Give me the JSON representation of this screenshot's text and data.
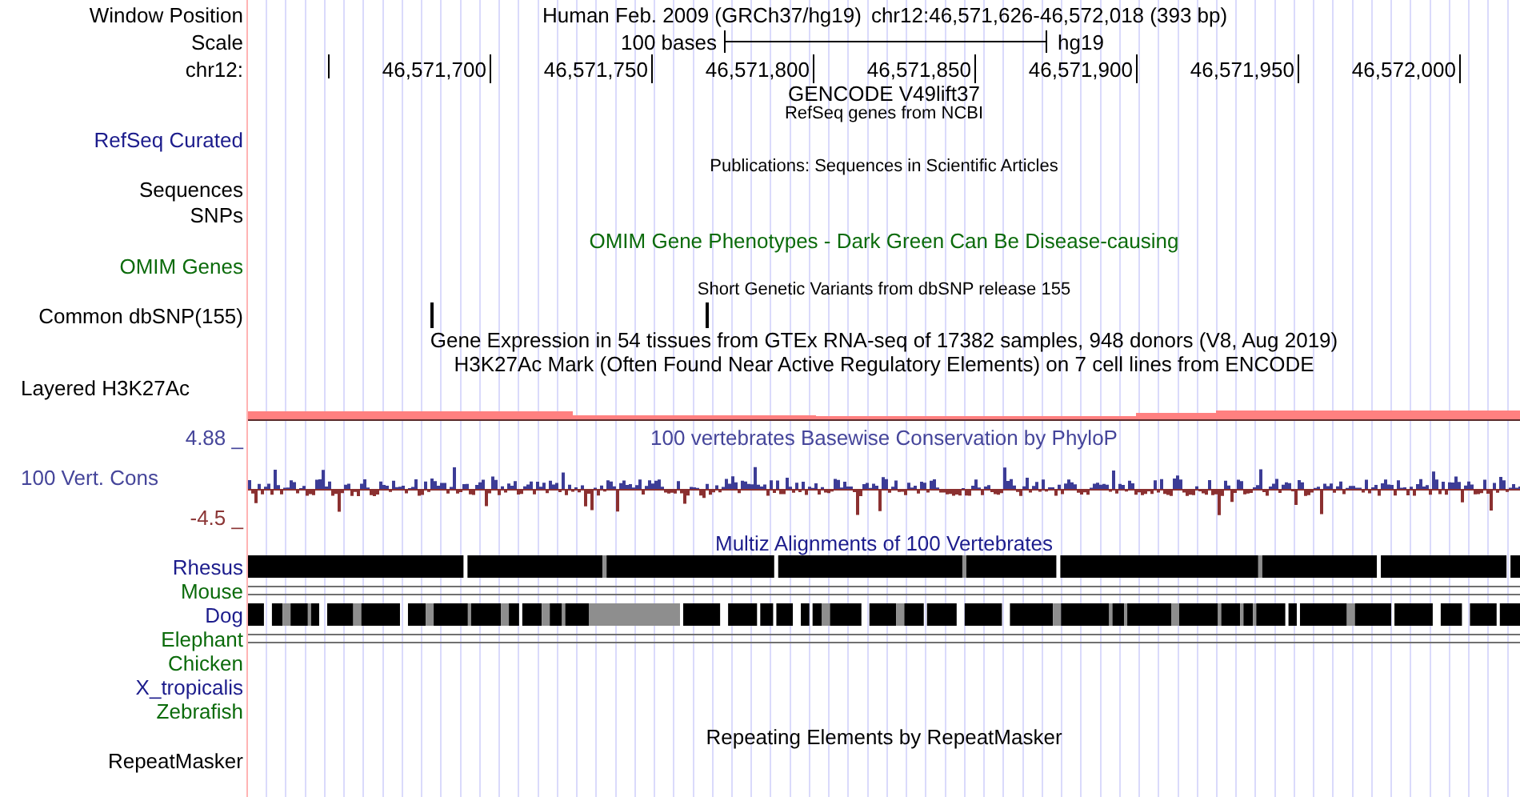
{
  "rows": [
    {
      "kind": "position",
      "label": "Window Position",
      "assembly": "Human Feb. 2009 (GRCh37/hg19)",
      "position": "chr12:46,571,626-46,572,018 (393 bp)"
    },
    {
      "kind": "scale",
      "label": "Scale",
      "length": "100 bases",
      "assembly": "hg19"
    },
    {
      "kind": "ruler",
      "label": "chr12:",
      "ticks": [
        "46,571,700",
        "46,571,750",
        "46,571,800",
        "46,571,850",
        "46,571,900",
        "46,571,950",
        "46,572,000"
      ]
    },
    {
      "kind": "title",
      "text": "GENCODE V49lift37",
      "color": "#000000"
    },
    {
      "kind": "caption",
      "text": "RefSeq genes from NCBI"
    },
    {
      "kind": "label",
      "label": "RefSeq Curated",
      "color": "#1c1c8c"
    },
    {
      "kind": "caption",
      "text": "Publications: Sequences in Scientific Articles"
    },
    {
      "kind": "label",
      "label": "Sequences",
      "color": "#000000"
    },
    {
      "kind": "label",
      "label": "SNPs",
      "color": "#000000"
    },
    {
      "kind": "title",
      "text": "OMIM Gene Phenotypes - Dark Green Can Be Disease-causing",
      "color": "#0b6b0b"
    },
    {
      "kind": "label",
      "label": "OMIM Genes",
      "color": "#0b6b0b"
    },
    {
      "kind": "caption",
      "text": "Short Genetic Variants from dbSNP release 155"
    },
    {
      "kind": "snps",
      "label": "Common dbSNP(155)",
      "color": "#000000"
    },
    {
      "kind": "title",
      "text": "Gene Expression in 54 tissues from GTEx RNA-seq of 17382 samples, 948 donors (V8, Aug 2019)",
      "color": "#000000"
    },
    {
      "kind": "title",
      "text": "H3K27Ac Mark (Often Found Near Active Regulatory Elements) on 7 cell lines from ENCODE",
      "color": "#000000"
    },
    {
      "kind": "signal",
      "label": "Layered H3K27Ac",
      "color": "#000000"
    },
    {
      "kind": "axis",
      "label": "4.88 _",
      "text": "100 vertebrates Basewise Conservation by PhyloP",
      "color": "#45459a"
    },
    {
      "kind": "wiggle",
      "label": "100 Vert. Cons",
      "min": "-4.5 _",
      "color": "#45459a"
    },
    {
      "kind": "title",
      "text": "Multiz Alignments of 100 Vertebrates",
      "color": "#1c1c8c"
    },
    {
      "kind": "bar",
      "label": "Rhesus",
      "color": "#1c1c8c"
    },
    {
      "kind": "lines",
      "label": "Mouse",
      "color": "#0b6b0b"
    },
    {
      "kind": "bar",
      "label": "Dog",
      "color": "#1c1c8c"
    },
    {
      "kind": "lines",
      "label": "Elephant",
      "color": "#0b6b0b"
    },
    {
      "kind": "empty",
      "label": "Chicken",
      "color": "#0b6b0b"
    },
    {
      "kind": "empty",
      "label": "X_tropicalis",
      "color": "#1c1c8c"
    },
    {
      "kind": "empty",
      "label": "Zebrafish",
      "color": "#0b6b0b"
    },
    {
      "kind": "title",
      "text": "Repeating Elements by RepeatMasker",
      "color": "#000000"
    },
    {
      "kind": "label",
      "label": "RepeatMasker",
      "color": "#000000"
    }
  ]
}
